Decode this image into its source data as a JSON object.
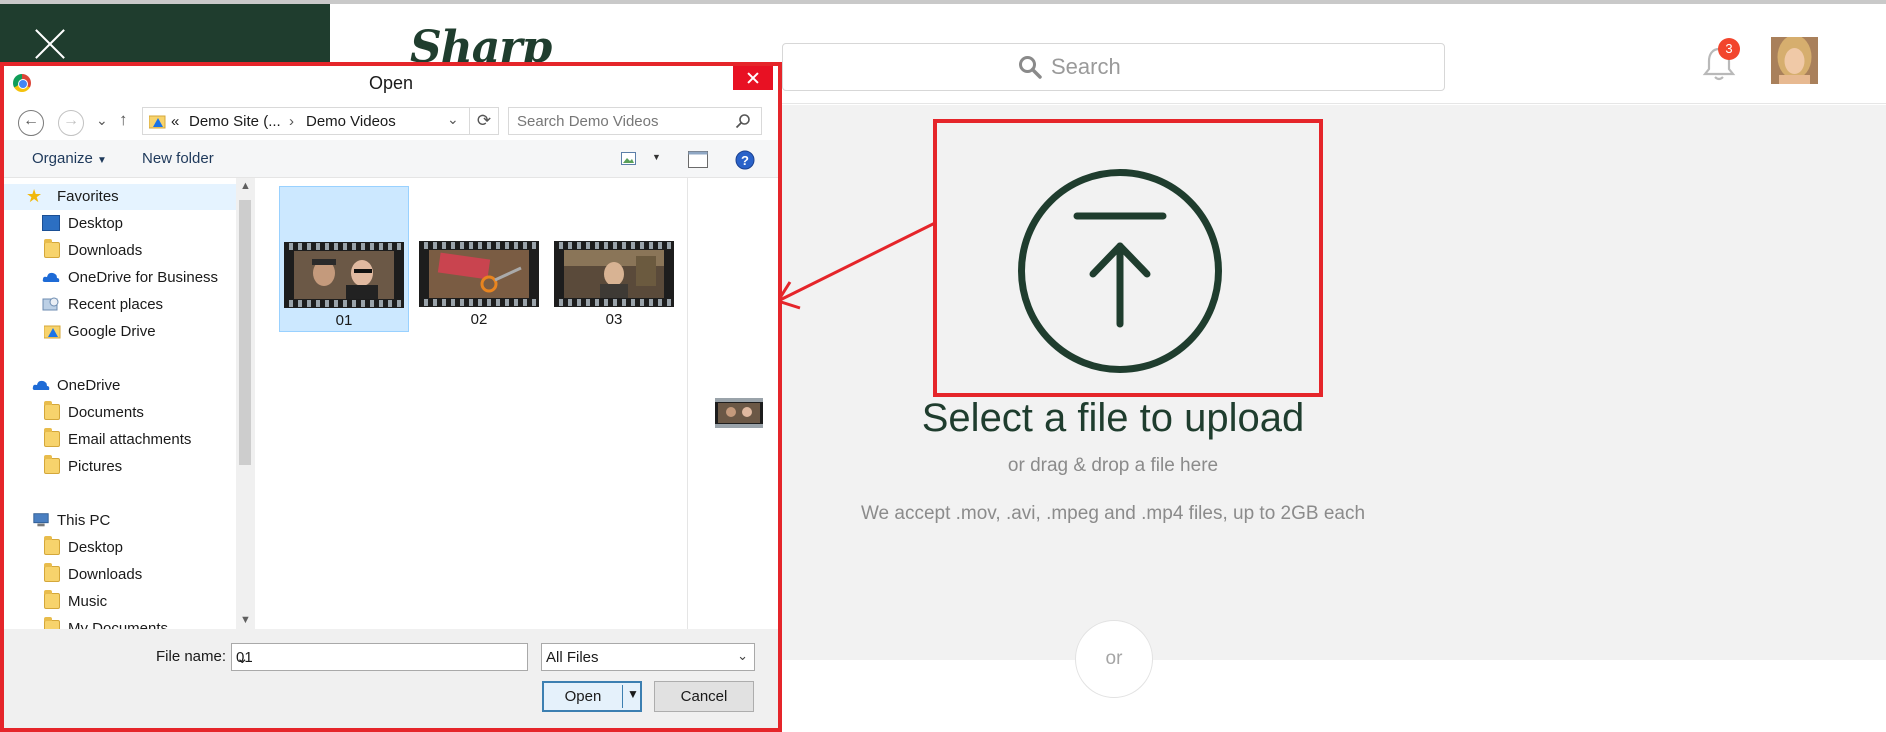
{
  "app": {
    "brand": "Sharp",
    "search_placeholder": "Search",
    "notification_count": "3",
    "upload": {
      "title": "Select a file to upload",
      "subtitle": "or drag & drop a file here",
      "note": "We accept .mov, .avi, .mpeg and .mp4 files, up to 2GB each",
      "or_label": "or"
    }
  },
  "colors": {
    "brand_dark": "#1f3d2e",
    "highlight_red": "#e5252a",
    "badge": "#f2452d",
    "accent_blue": "#3c7fb1"
  },
  "dialog": {
    "title": "Open",
    "address": {
      "overflow": "«",
      "segment1": "Demo Site (...",
      "segment2": "Demo Videos"
    },
    "search_placeholder": "Search Demo Videos",
    "toolbar": {
      "organize": "Organize",
      "new_folder": "New folder"
    },
    "nav": {
      "favorites": "Favorites",
      "fav_items": [
        "Desktop",
        "Downloads",
        "OneDrive for Business",
        "Recent places",
        "Google Drive"
      ],
      "onedrive": "OneDrive",
      "onedrive_items": [
        "Documents",
        "Email attachments",
        "Pictures"
      ],
      "this_pc": "This PC",
      "pc_items": [
        "Desktop",
        "Downloads",
        "Music",
        "My Documents"
      ]
    },
    "files": [
      {
        "name": "01",
        "selected": true
      },
      {
        "name": "02",
        "selected": false
      },
      {
        "name": "03",
        "selected": false
      }
    ],
    "file_name_label": "File name:",
    "file_name_value": "01",
    "file_type": "All Files",
    "open_label": "Open",
    "cancel_label": "Cancel"
  }
}
